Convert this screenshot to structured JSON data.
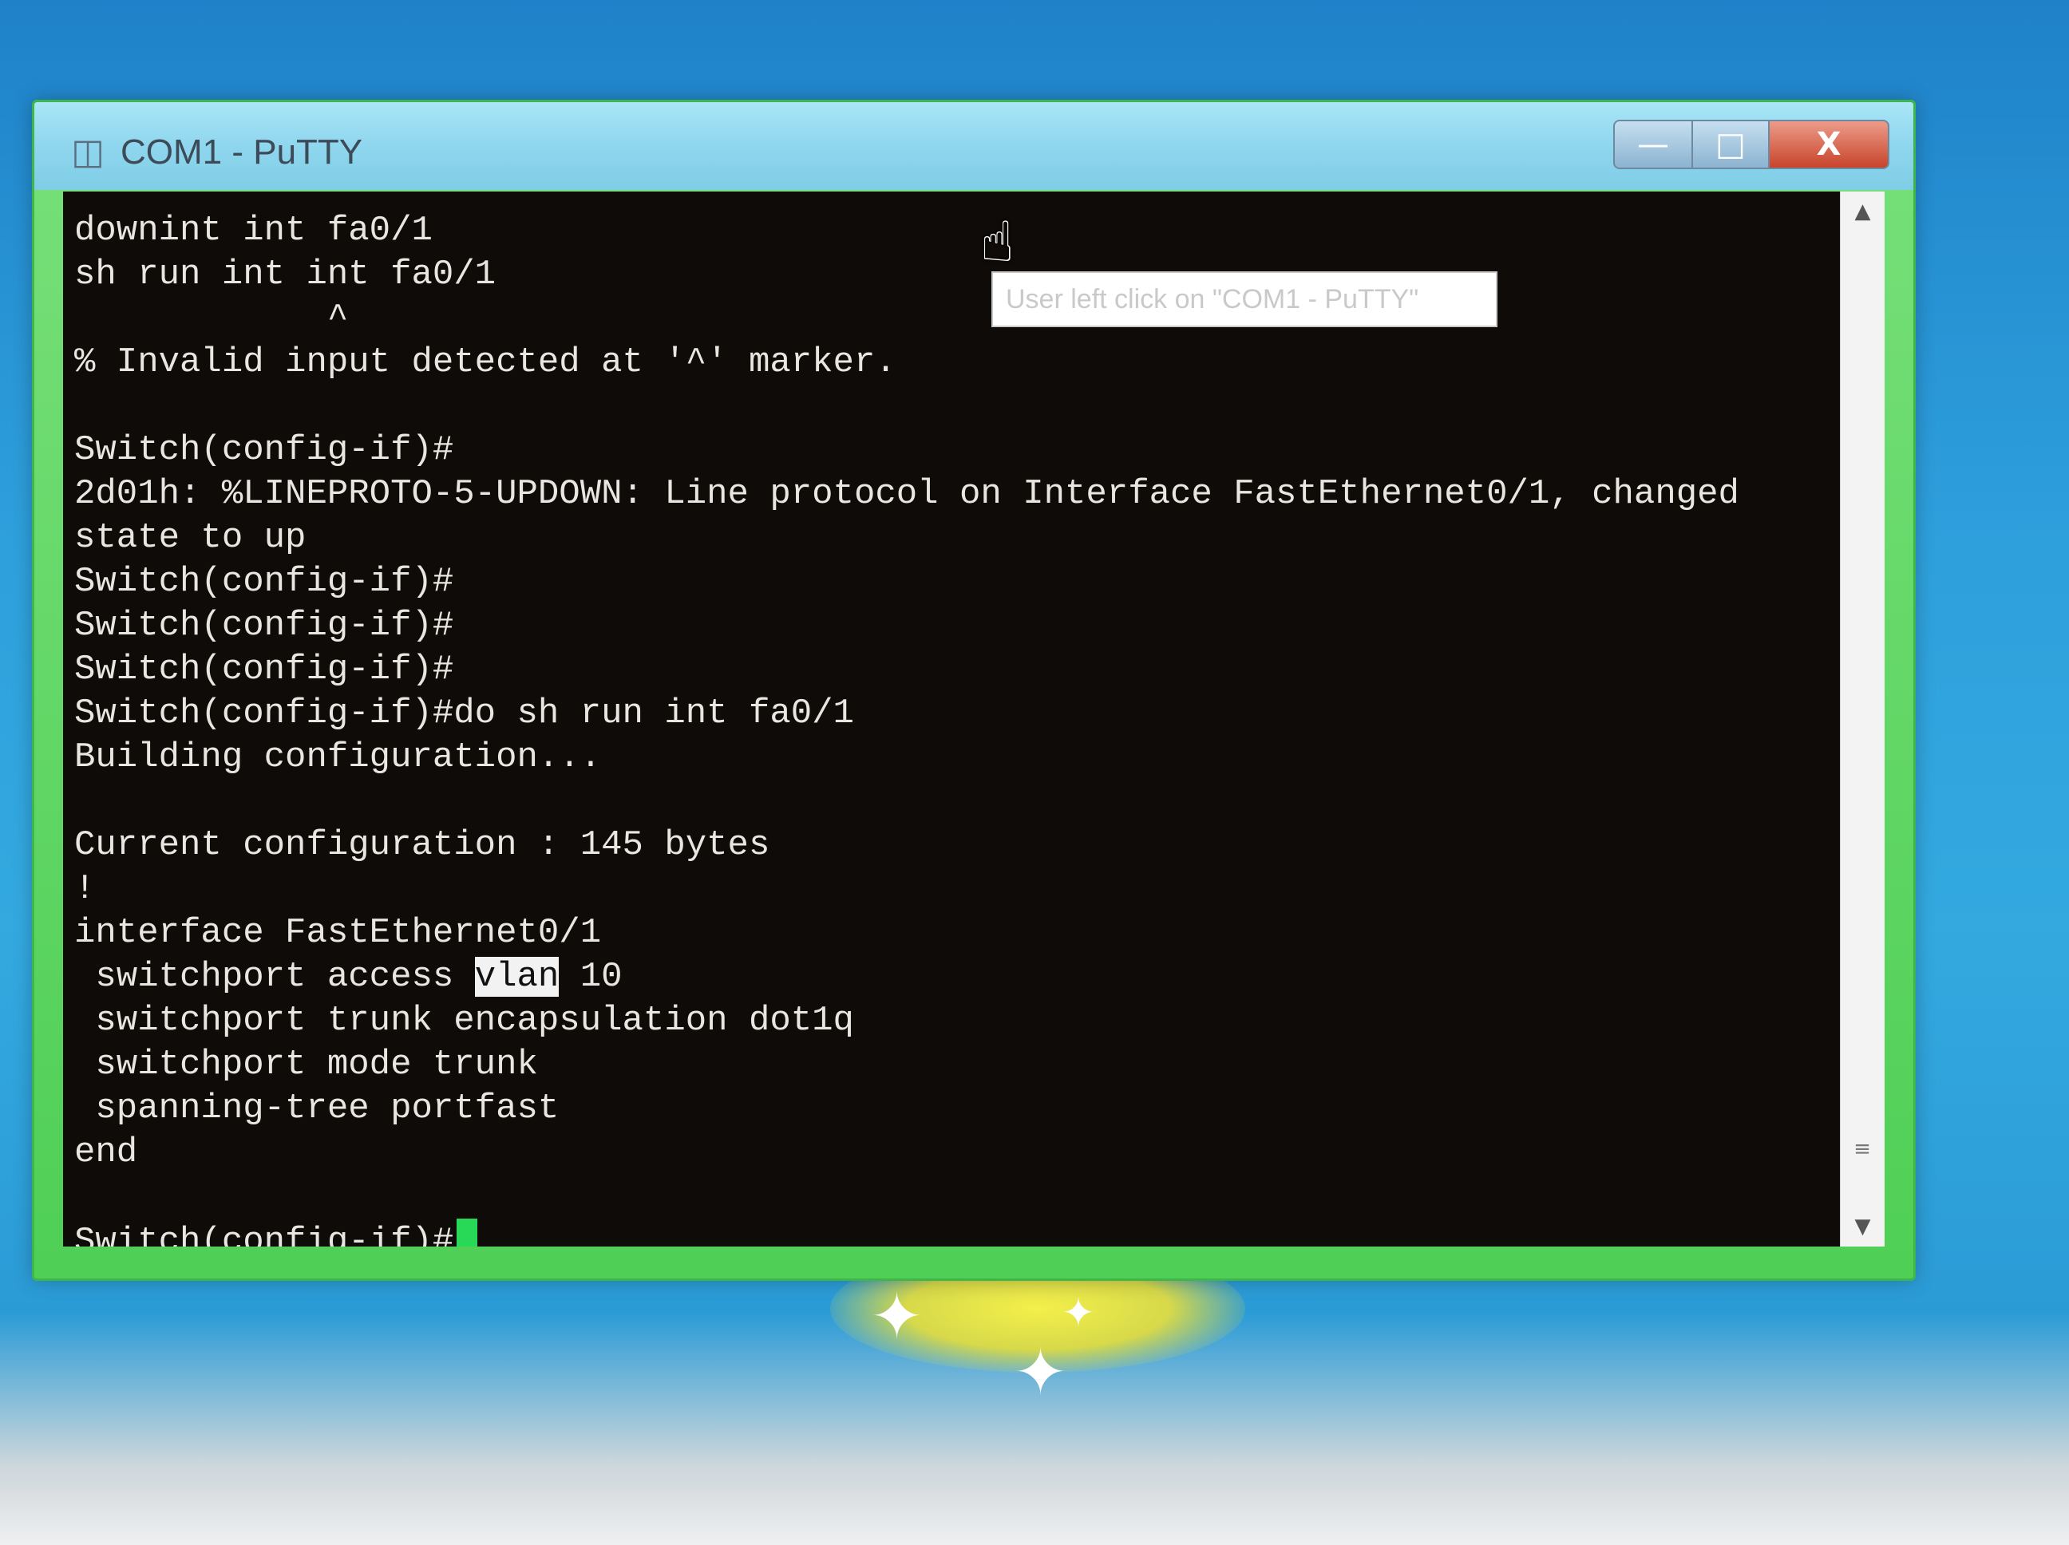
{
  "window": {
    "title": "COM1 - PuTTY",
    "icon": "putty-icon",
    "controls": {
      "minimize": "—",
      "maximize": "□",
      "close": "X"
    }
  },
  "terminal": {
    "lines": [
      "downint int fa0/1",
      "sh run int int fa0/1",
      "            ^",
      "% Invalid input detected at '^' marker.",
      "",
      "Switch(config-if)#",
      "2d01h: %LINEPROTO-5-UPDOWN: Line protocol on Interface FastEthernet0/1, changed",
      "state to up",
      "Switch(config-if)#",
      "Switch(config-if)#",
      "Switch(config-if)#",
      "Switch(config-if)#do sh run int fa0/1",
      "Building configuration...",
      "",
      "Current configuration : 145 bytes",
      "!",
      "interface FastEthernet0/1"
    ],
    "access_line": {
      "before": " switchport access ",
      "highlight": "vlan",
      "after": " 10"
    },
    "tail_lines": [
      " switchport trunk encapsulation dot1q",
      " switchport mode trunk",
      " spanning-tree portfast",
      "end",
      ""
    ],
    "prompt": "Switch(config-if)#",
    "cursor_color": "#27d957"
  },
  "tooltip": {
    "text": "User left click on \"COM1 - PuTTY\""
  },
  "colors": {
    "terminal_bg": "#0e0b08",
    "terminal_fg": "#e8e6e1",
    "window_frame": "#4fcf55",
    "desktop": "#2ea0dc"
  }
}
